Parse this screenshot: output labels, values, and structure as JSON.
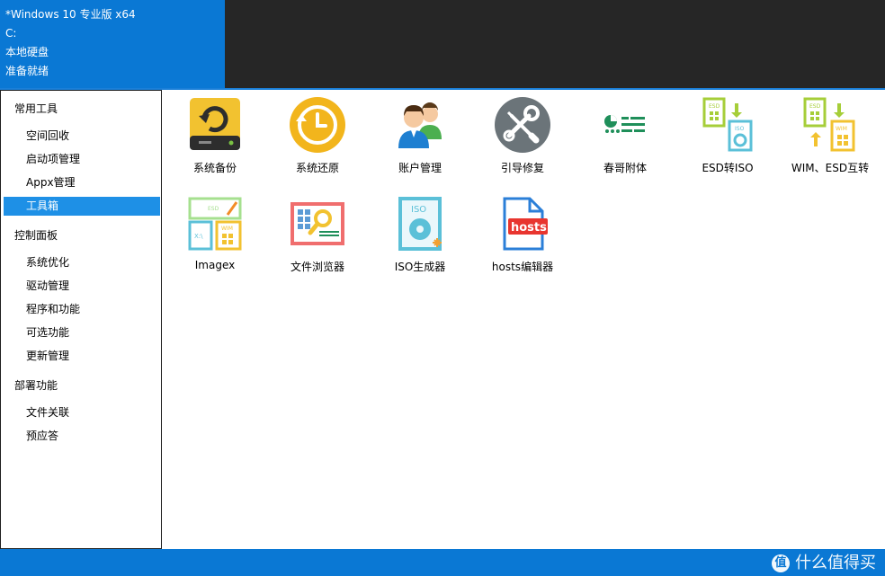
{
  "header": {
    "edition": "*Windows 10 专业版 x64",
    "drive": "C:",
    "drive_type": "本地硬盘",
    "status": "准备就绪"
  },
  "sidebar": {
    "groups": [
      {
        "label": "常用工具",
        "items": [
          {
            "label": "空间回收"
          },
          {
            "label": "启动项管理"
          },
          {
            "label": "Appx管理"
          },
          {
            "label": "工具箱",
            "selected": true
          }
        ]
      },
      {
        "label": "控制面板",
        "items": [
          {
            "label": "系统优化"
          },
          {
            "label": "驱动管理"
          },
          {
            "label": "程序和功能"
          },
          {
            "label": "可选功能"
          },
          {
            "label": "更新管理"
          }
        ]
      },
      {
        "label": "部署功能",
        "items": [
          {
            "label": "文件关联"
          },
          {
            "label": "预应答"
          }
        ]
      }
    ]
  },
  "tools": [
    {
      "label": "系统备份",
      "icon": "backup-drive-icon"
    },
    {
      "label": "系统还原",
      "icon": "restore-clock-icon"
    },
    {
      "label": "账户管理",
      "icon": "users-icon"
    },
    {
      "label": "引导修复",
      "icon": "wrench-screwdriver-icon"
    },
    {
      "label": "春哥附体",
      "icon": "settings-list-icon"
    },
    {
      "label": "ESD转ISO",
      "icon": "esd-to-iso-icon"
    },
    {
      "label": "WIM、ESD互转",
      "icon": "wim-esd-convert-icon"
    },
    {
      "label": "Imagex",
      "icon": "imagex-icon"
    },
    {
      "label": "文件浏览器",
      "icon": "file-browser-icon"
    },
    {
      "label": "ISO生成器",
      "icon": "iso-generator-icon"
    },
    {
      "label": "hosts编辑器",
      "icon": "hosts-editor-icon",
      "badge": "hosts"
    }
  ],
  "watermark": {
    "logo": "值",
    "text": "什么值得买"
  },
  "colors": {
    "accent": "#0a78d4",
    "dark": "#262626",
    "selected": "#1e90e6"
  }
}
